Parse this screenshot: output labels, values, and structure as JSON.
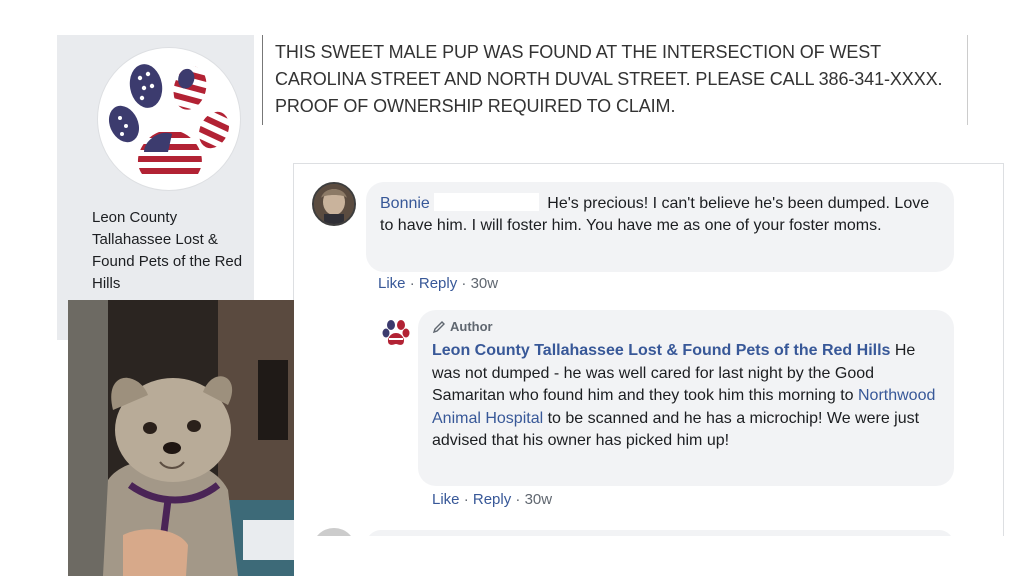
{
  "page": {
    "name": "Leon County Tallahassee Lost & Found Pets of the Red Hills",
    "logo_icon": "flag-paw-icon"
  },
  "post": {
    "text": "THIS SWEET MALE PUP WAS FOUND AT THE INTERSECTION OF WEST CAROLINA STREET AND NORTH DUVAL STREET. PLEASE CALL 386-341-XXXX. PROOF OF OWNERSHIP REQUIRED TO CLAIM."
  },
  "photo": {
    "subject_icon": "dog-photo"
  },
  "comments": [
    {
      "author": "Bonnie",
      "text": "He's precious! I can't believe he's been dumped. Love to have him. I will foster him. You have me as one of your foster moms.",
      "like_label": "Like",
      "reply_label": "Reply",
      "time": "30w"
    }
  ],
  "reply": {
    "author_badge": "Author",
    "author": "Leon County Tallahassee Lost & Found Pets of the Red Hills",
    "text_before_link": "He was not dumped - he was well cared for last night by the Good Samaritan who found him and they took him this morning to ",
    "link_text": "Northwood Animal Hospital",
    "text_after_link": " to be scanned and he has a microchip! We were just advised that his owner has picked him up!",
    "like_label": "Like",
    "reply_label": "Reply",
    "time": "30w"
  },
  "separator": "·",
  "colors": {
    "link": "#385898",
    "bubble": "#f2f3f5",
    "sidebar": "#e9ebee",
    "flag_red": "#b22234",
    "flag_blue": "#3c3b6e"
  }
}
